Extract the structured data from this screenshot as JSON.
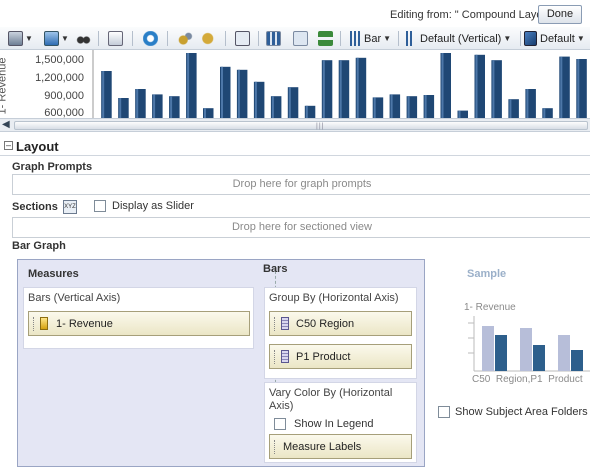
{
  "header": {
    "editing_text": "Editing from: \" Compound Layout\"",
    "done_label": "Done"
  },
  "toolbar": {
    "chart_type_label": "Bar",
    "orientation_label": "Default (Vertical)",
    "style_label": "Default"
  },
  "chart_data": {
    "type": "bar",
    "ylabel": "1- Revenue",
    "yticks": [
      "1,500,000",
      "1,200,000",
      "900,000",
      "600,000"
    ],
    "ylim": [
      600000,
      1600000
    ],
    "values": [
      1300000,
      850000,
      1000000,
      910000,
      880000,
      1600000,
      680000,
      1370000,
      1320000,
      1120000,
      880000,
      1030000,
      720000,
      1480000,
      1480000,
      1520000,
      860000,
      910000,
      880000,
      900000,
      1600000,
      640000,
      1570000,
      1480000,
      830000,
      1000000,
      680000,
      1540000,
      1500000
    ],
    "grid": false,
    "colors": {
      "bar": "#1f4774",
      "bar_highlight": "#4d77a8"
    }
  },
  "layout": {
    "title": "Layout",
    "graph_prompts_label": "Graph Prompts",
    "graph_prompts_drop": "Drop here for graph prompts",
    "sections_label": "Sections",
    "display_as_slider": "Display as Slider",
    "sections_drop": "Drop here for sectioned view",
    "bar_graph_label": "Bar Graph"
  },
  "panel": {
    "measures_title": "Measures",
    "bars_vertical_axis": "Bars (Vertical Axis)",
    "measure_item": "1- Revenue",
    "bars_title": "Bars",
    "group_by": "Group By (Horizontal Axis)",
    "group_items": [
      "C50  Region",
      "P1  Product"
    ],
    "vary_color": "Vary Color By (Horizontal Axis)",
    "show_in_legend": "Show In Legend",
    "measure_labels": "Measure Labels"
  },
  "sample": {
    "title": "Sample",
    "axis_label": "1- Revenue",
    "categories": [
      "C50  Region,P1  Product"
    ],
    "colors": {
      "light": "#b7bed9",
      "dark": "#2d5f8c"
    }
  },
  "subject_area": {
    "label": "Show Subject Area Folders"
  }
}
